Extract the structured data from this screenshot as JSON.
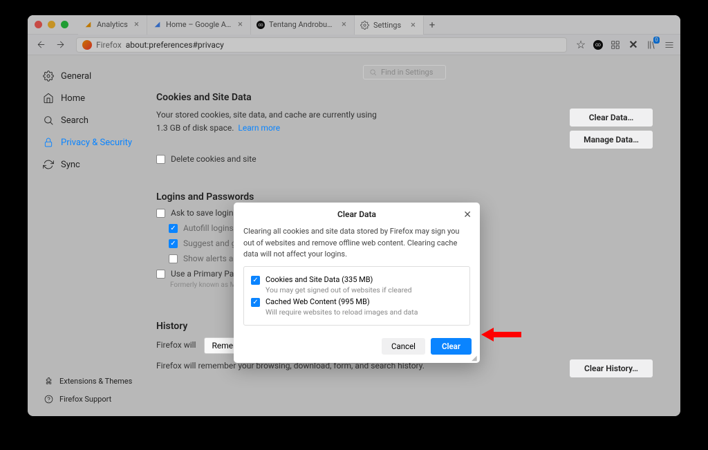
{
  "tabs": [
    {
      "label": "Analytics",
      "favicon_color": "#f29900"
    },
    {
      "label": "Home – Google AdSense",
      "favicon_color": "#4285f4"
    },
    {
      "label": "Tentang Androbuntu",
      "favicon_color": "#111"
    },
    {
      "label": "Settings",
      "favicon_color": "#555",
      "active": true
    }
  ],
  "url_prefix": "Firefox",
  "url": "about:preferences#privacy",
  "toolbar_badge": "0",
  "search_placeholder": "Find in Settings",
  "sidebar": {
    "items": [
      {
        "id": "general",
        "label": "General"
      },
      {
        "id": "home",
        "label": "Home"
      },
      {
        "id": "search",
        "label": "Search"
      },
      {
        "id": "privacy",
        "label": "Privacy & Security",
        "active": true
      },
      {
        "id": "sync",
        "label": "Sync"
      }
    ],
    "footer": [
      {
        "id": "ext",
        "label": "Extensions & Themes"
      },
      {
        "id": "support",
        "label": "Firefox Support"
      }
    ]
  },
  "cookies": {
    "title": "Cookies and Site Data",
    "text_a": "Your stored cookies, site data, and cache are currently using 1.3 GB of disk space.",
    "learn_more": "Learn more",
    "clear_btn": "Clear Data…",
    "manage_btn": "Manage Data…",
    "delete_check": "Delete cookies and site"
  },
  "logins": {
    "title": "Logins and Passwords",
    "ask": "Ask to save logins and",
    "autofill": "Autofill logins and p",
    "suggest": "Suggest and gener",
    "alerts": "Show alerts about p",
    "primary": "Use a Primary Passwo",
    "note": "Formerly known as Master Password"
  },
  "history": {
    "title": "History",
    "will": "Firefox will",
    "select_value": "Remember history",
    "remember_text": "Firefox will remember your browsing, download, form, and search history.",
    "clear_btn": "Clear History…"
  },
  "dialog": {
    "title": "Clear Data",
    "desc": "Clearing all cookies and site data stored by Firefox may sign you out of websites and remove offline web content. Clearing cache data will not affect your logins.",
    "opt1_label": "Cookies and Site Data (335 MB)",
    "opt1_sub": "You may get signed out of websites if cleared",
    "opt2_label": "Cached Web Content (995 MB)",
    "opt2_sub": "Will require websites to reload images and data",
    "cancel": "Cancel",
    "clear": "Clear"
  }
}
